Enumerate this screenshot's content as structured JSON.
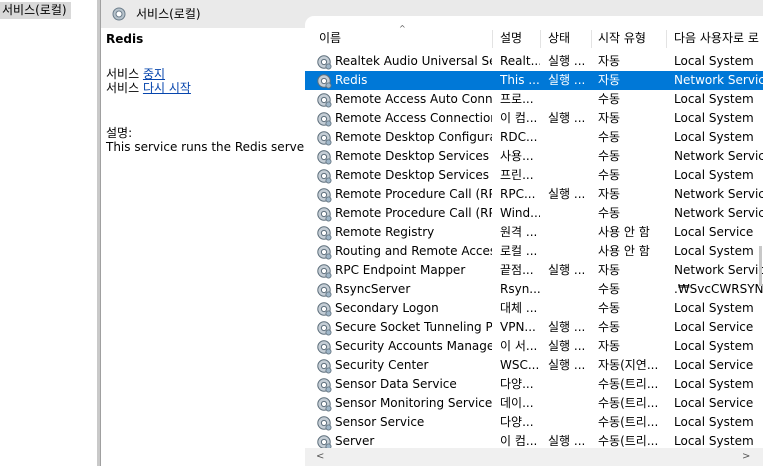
{
  "tree": {
    "root_label": "서비스(로컬)"
  },
  "header": {
    "title": "서비스(로컬)"
  },
  "description": {
    "service_name": "Redis",
    "stop_prefix": "서비스 ",
    "stop_link": "중지",
    "restart_prefix": "서비스 ",
    "restart_link": "다시 시작",
    "desc_label": "설명:",
    "desc_text": "This service runs the Redis server"
  },
  "columns": {
    "sort_indicator": "^",
    "name": "이름",
    "desc": "설명",
    "state": "상태",
    "start": "시작 유형",
    "logon": "다음 사용자로 로"
  },
  "rows": [
    {
      "name": "Realtek Audio Universal Ser...",
      "desc": "Realt...",
      "state": "실행 ...",
      "start": "자동",
      "logon": "Local System"
    },
    {
      "name": "Redis",
      "desc": "This ...",
      "state": "실행 ...",
      "start": "자동",
      "logon": "Network Service"
    },
    {
      "name": "Remote Access Auto Conn...",
      "desc": "프로...",
      "state": "",
      "start": "수동",
      "logon": "Local System"
    },
    {
      "name": "Remote Access Connection...",
      "desc": "이 컴...",
      "state": "실행 ...",
      "start": "자동",
      "logon": "Local System"
    },
    {
      "name": "Remote Desktop Configura...",
      "desc": "RDC...",
      "state": "",
      "start": "수동",
      "logon": "Local System"
    },
    {
      "name": "Remote Desktop Services",
      "desc": "사용...",
      "state": "",
      "start": "수동",
      "logon": "Network Service"
    },
    {
      "name": "Remote Desktop Services ...",
      "desc": "프린...",
      "state": "",
      "start": "수동",
      "logon": "Local System"
    },
    {
      "name": "Remote Procedure Call (RP...",
      "desc": "RPC...",
      "state": "실행 ...",
      "start": "자동",
      "logon": "Network Service"
    },
    {
      "name": "Remote Procedure Call (RP...",
      "desc": "Wind...",
      "state": "",
      "start": "수동",
      "logon": "Network Service"
    },
    {
      "name": "Remote Registry",
      "desc": "원격 ...",
      "state": "",
      "start": "사용 안 함",
      "logon": "Local Service"
    },
    {
      "name": "Routing and Remote Access",
      "desc": "로컬 ...",
      "state": "",
      "start": "사용 안 함",
      "logon": "Local System"
    },
    {
      "name": "RPC Endpoint Mapper",
      "desc": "끝점...",
      "state": "실행 ...",
      "start": "자동",
      "logon": "Network Service"
    },
    {
      "name": "RsyncServer",
      "desc": "Rsyn...",
      "state": "",
      "start": "수동",
      "logon": ".₩SvcCWRSYNC"
    },
    {
      "name": "Secondary Logon",
      "desc": "대체 ...",
      "state": "",
      "start": "수동",
      "logon": "Local System"
    },
    {
      "name": "Secure Socket Tunneling P...",
      "desc": "VPN...",
      "state": "실행 ...",
      "start": "수동",
      "logon": "Local Service"
    },
    {
      "name": "Security Accounts Manager",
      "desc": "이 서...",
      "state": "실행 ...",
      "start": "자동",
      "logon": "Local System"
    },
    {
      "name": "Security Center",
      "desc": "WSC...",
      "state": "실행 ...",
      "start": "자동(지연...",
      "logon": "Local Service"
    },
    {
      "name": "Sensor Data Service",
      "desc": "다양...",
      "state": "",
      "start": "수동(트리...",
      "logon": "Local System"
    },
    {
      "name": "Sensor Monitoring Service",
      "desc": "데이...",
      "state": "",
      "start": "수동(트리...",
      "logon": "Local Service"
    },
    {
      "name": "Sensor Service",
      "desc": "다양...",
      "state": "",
      "start": "수동(트리...",
      "logon": "Local System"
    },
    {
      "name": "Server",
      "desc": "이 컴...",
      "state": "실행 ...",
      "start": "수동(트리...",
      "logon": "Local System"
    }
  ],
  "selected_index": 1,
  "scroll": {
    "left_arrow": "<",
    "right_arrow": ">"
  }
}
